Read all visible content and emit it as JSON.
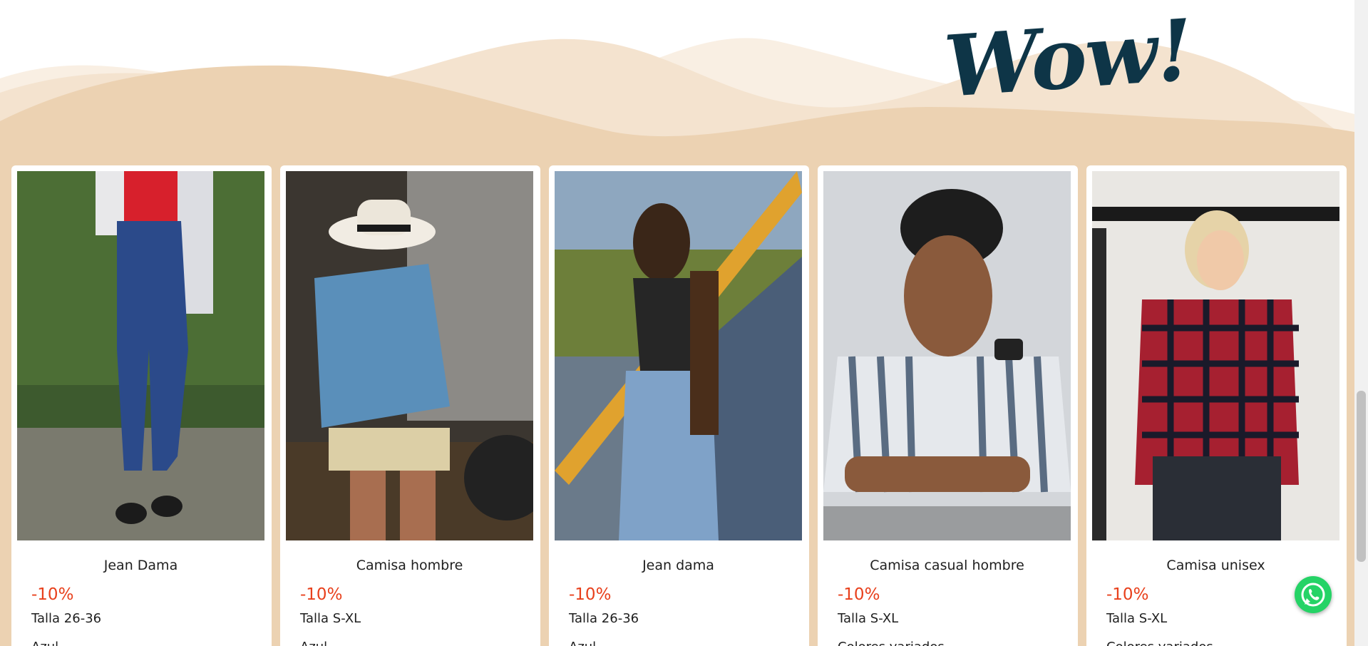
{
  "hero": {
    "wow_text": "Wow!",
    "colors": {
      "wave_dark": "#ecd2b2",
      "wave_light": "#f4e3cf",
      "wave_pale": "#f9efe3",
      "wow": "#0e3547"
    }
  },
  "products": [
    {
      "title": "Jean Dama",
      "discount": "-10%",
      "size": "Talla 26-36",
      "extra": "Azul",
      "image": "woman-jeans-photo"
    },
    {
      "title": "Camisa hombre",
      "discount": "-10%",
      "size": "Talla S-XL",
      "extra": "Azul",
      "image": "man-hat-shirt-photo"
    },
    {
      "title": "Jean dama",
      "discount": "-10%",
      "size": "Talla 26-36",
      "extra": "Azul",
      "image": "woman-stairs-photo"
    },
    {
      "title": "Camisa casual hombre",
      "discount": "-10%",
      "size": "Talla S-XL",
      "extra": "Colores variados",
      "image": "man-striped-shirt-photo"
    },
    {
      "title": "Camisa unisex",
      "discount": "-10%",
      "size": "Talla S-XL",
      "extra": "Colores variados",
      "image": "woman-plaid-shirt-photo"
    }
  ],
  "whatsapp": {
    "icon": "whatsapp-icon",
    "color": "#25d366"
  },
  "accent_discount_color": "#e8401c"
}
